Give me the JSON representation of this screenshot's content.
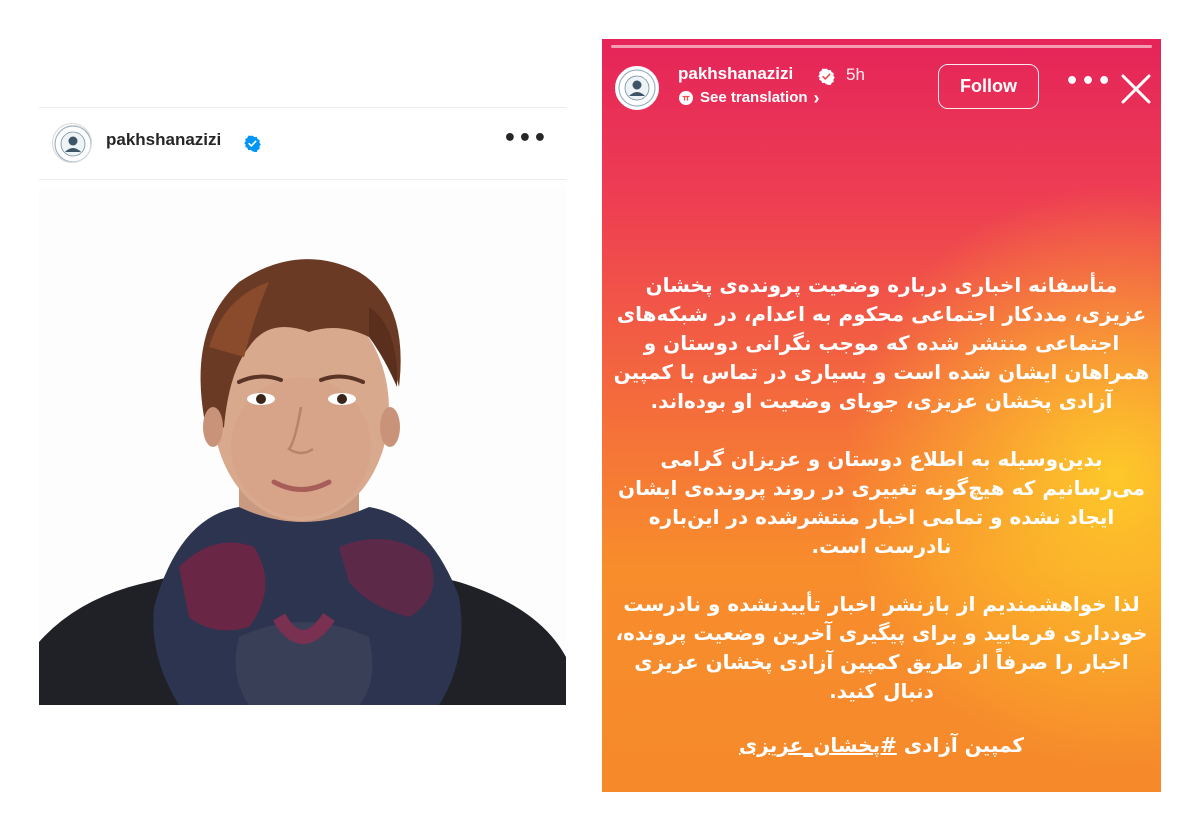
{
  "post": {
    "username": "pakhshanazizi",
    "more_icon": "ellipsis-icon",
    "verified_icon": "verified-badge-icon"
  },
  "story": {
    "username": "pakhshanazizi",
    "time": "5h",
    "see_translation": "See translation",
    "follow_label": "Follow",
    "more_icon": "ellipsis-icon",
    "close_icon": "close-icon",
    "paragraphs": [
      "متأسفانه اخباری درباره وضعیت پرونده‌ی پخشان عزیزی، مددکار اجتماعی محکوم به اعدام، در شبکه‌های اجتماعی منتشر شده که موجب نگرانی دوستان و همراهان ایشان شده است و بسیاری در تماس با کمپین آزادی پخشان عزیزی، جویای وضعیت او بوده‌اند.",
      "بدین‌وسیله به اطلاع دوستان و عزیزان گرامی می‌رسانیم که هیچ‌گونه تغییری در روند پرونده‌ی ایشان ایجاد نشده و تمامی اخبار منتشرشده در این‌باره نادرست است.",
      "لذا خواهشمندیم از بازنشر اخبار تأییدنشده و نادرست خودداری فرمایید و برای پیگیری آخرین وضعیت پرونده، اخبار را صرفاً از طریق کمپین آزادی پخشان عزیزی دنبال کنید."
    ],
    "campaign_prefix": "کمپین آزادی ",
    "hashtag": "#پخشان_عزیزی"
  },
  "colors": {
    "verified_blue": "#0095f6",
    "story_top": "#e5245a",
    "story_bottom": "#f68a2b"
  }
}
